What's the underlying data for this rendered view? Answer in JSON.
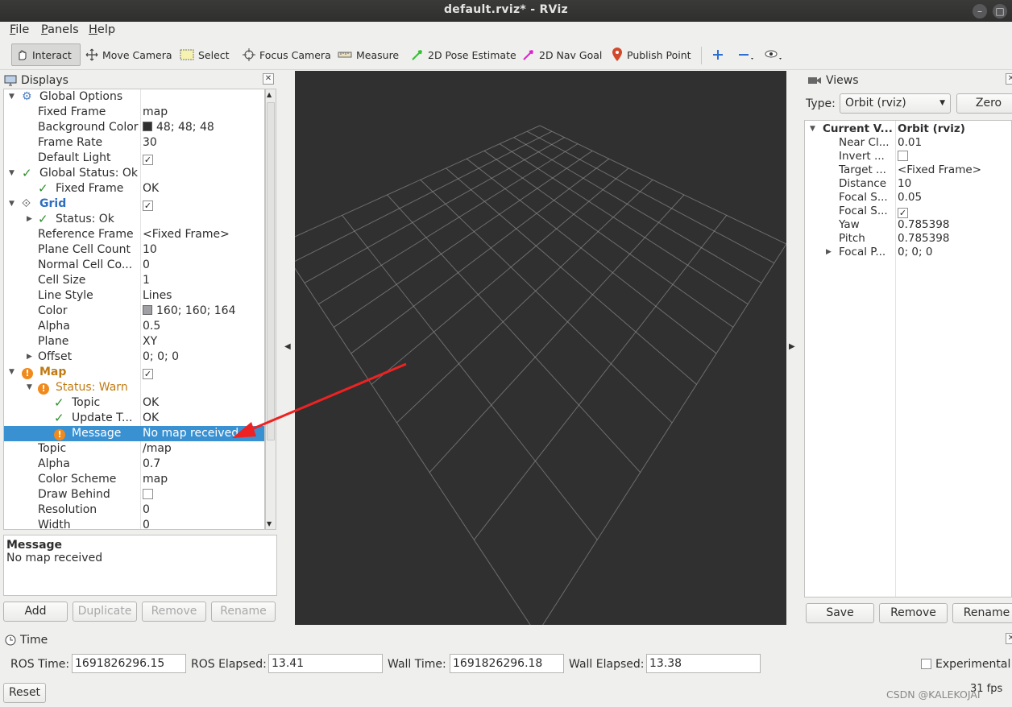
{
  "window": {
    "title": "default.rviz* - RViz"
  },
  "menu": {
    "file": "File",
    "panels": "Panels",
    "help": "Help"
  },
  "toolbar": {
    "interact": "Interact",
    "move_camera": "Move Camera",
    "select": "Select",
    "focus_camera": "Focus Camera",
    "measure": "Measure",
    "pose_estimate": "2D Pose Estimate",
    "nav_goal": "2D Nav Goal",
    "publish_point": "Publish Point"
  },
  "displays": {
    "title": "Displays",
    "rows": [
      {
        "label": "Global Options",
        "value": ""
      },
      {
        "label": "Fixed Frame",
        "value": "map"
      },
      {
        "label": "Background Color",
        "value": "48; 48; 48"
      },
      {
        "label": "Frame Rate",
        "value": "30"
      },
      {
        "label": "Default Light",
        "value": ""
      },
      {
        "label": "Global Status: Ok",
        "value": ""
      },
      {
        "label": "Fixed Frame",
        "value": "OK"
      },
      {
        "label": "Grid",
        "value": ""
      },
      {
        "label": "Status: Ok",
        "value": ""
      },
      {
        "label": "Reference Frame",
        "value": "<Fixed Frame>"
      },
      {
        "label": "Plane Cell Count",
        "value": "10"
      },
      {
        "label": "Normal Cell Co...",
        "value": "0"
      },
      {
        "label": "Cell Size",
        "value": "1"
      },
      {
        "label": "Line Style",
        "value": "Lines"
      },
      {
        "label": "Color",
        "value": "160; 160; 164"
      },
      {
        "label": "Alpha",
        "value": "0.5"
      },
      {
        "label": "Plane",
        "value": "XY"
      },
      {
        "label": "Offset",
        "value": "0; 0; 0"
      },
      {
        "label": "Map",
        "value": ""
      },
      {
        "label": "Status: Warn",
        "value": ""
      },
      {
        "label": "Topic",
        "value": "OK"
      },
      {
        "label": "Update T...",
        "value": "OK"
      },
      {
        "label": "Message",
        "value": "No map received"
      },
      {
        "label": "Topic",
        "value": "/map"
      },
      {
        "label": "Alpha",
        "value": "0.7"
      },
      {
        "label": "Color Scheme",
        "value": "map"
      },
      {
        "label": "Draw Behind",
        "value": ""
      },
      {
        "label": "Resolution",
        "value": "0"
      },
      {
        "label": "Width",
        "value": "0"
      }
    ],
    "colors": {
      "background_color": "#303030",
      "grid_color": "#a0a0a4",
      "selection": "#3a91d2",
      "warn": "#f08a1c",
      "grid_label": "#2f6fbf",
      "map_label": "#c07a12"
    },
    "message_title": "Message",
    "message_text": "No map received",
    "buttons": {
      "add": "Add",
      "duplicate": "Duplicate",
      "remove": "Remove",
      "rename": "Rename"
    }
  },
  "views": {
    "title": "Views",
    "type_label": "Type:",
    "type_value": "Orbit (rviz)",
    "zero": "Zero",
    "rows": [
      {
        "label": "Current V...",
        "value": "Orbit (rviz)"
      },
      {
        "label": "Near Cl...",
        "value": "0.01"
      },
      {
        "label": "Invert ...",
        "value": ""
      },
      {
        "label": "Target ...",
        "value": "<Fixed Frame>"
      },
      {
        "label": "Distance",
        "value": "10"
      },
      {
        "label": "Focal S...",
        "value": "0.05"
      },
      {
        "label": "Focal S...",
        "value": ""
      },
      {
        "label": "Yaw",
        "value": "0.785398"
      },
      {
        "label": "Pitch",
        "value": "0.785398"
      },
      {
        "label": "Focal P...",
        "value": "0; 0; 0"
      }
    ],
    "buttons": {
      "save": "Save",
      "remove": "Remove",
      "rename": "Rename"
    }
  },
  "time": {
    "title": "Time",
    "ros_time_label": "ROS Time:",
    "ros_time": "1691826296.15",
    "ros_elapsed_label": "ROS Elapsed:",
    "ros_elapsed": "13.41",
    "wall_time_label": "Wall Time:",
    "wall_time": "1691826296.18",
    "wall_elapsed_label": "Wall Elapsed:",
    "wall_elapsed": "13.38",
    "experimental": "Experimental",
    "reset": "Reset",
    "fps": "31 fps"
  },
  "watermark": "CSDN @KALEKOJAI"
}
